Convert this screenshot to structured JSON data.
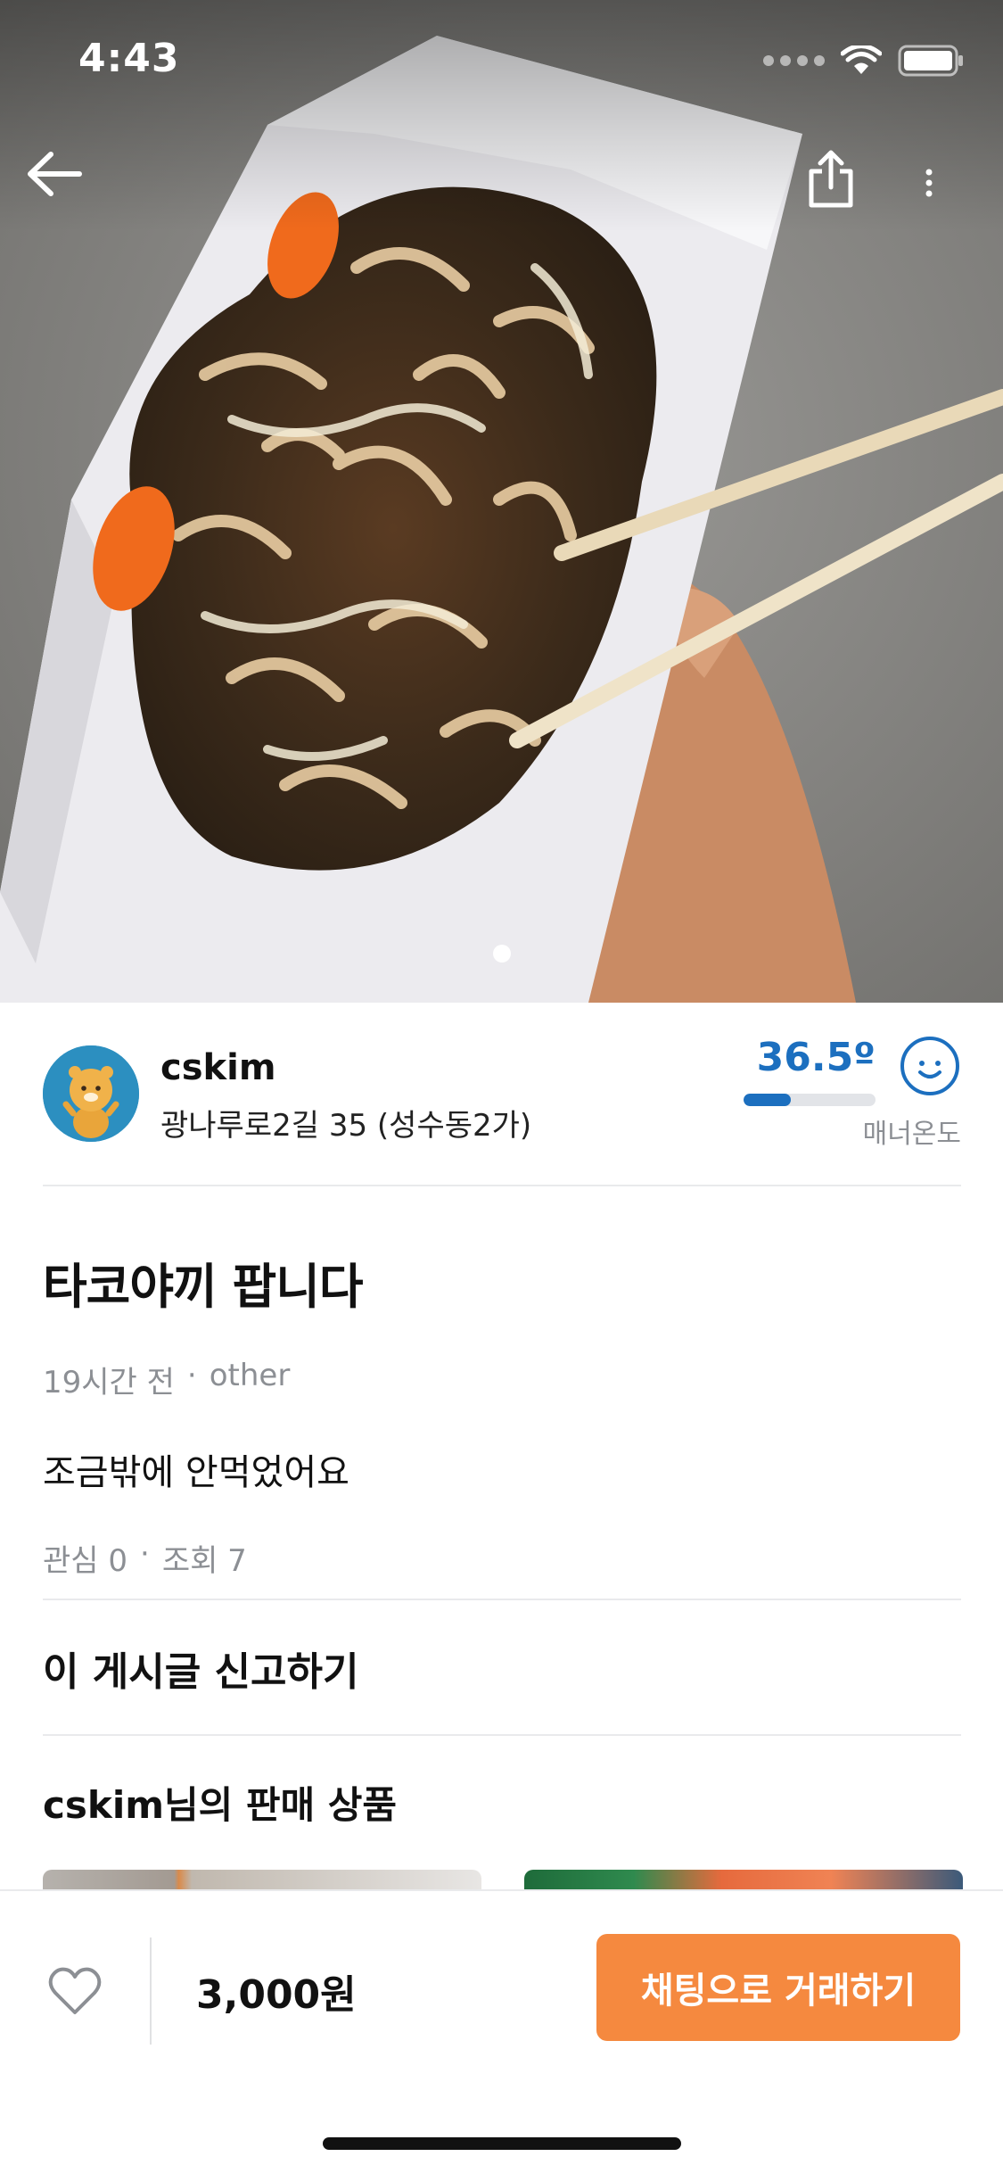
{
  "status_bar": {
    "time": "4:43"
  },
  "hero": {
    "image": "takoyaki-photo",
    "current_page": 1,
    "page_count": 1
  },
  "header": {
    "back_icon": "arrow-left-icon",
    "share_icon": "share-icon",
    "more_icon": "more-vertical-icon"
  },
  "seller": {
    "nickname": "cskim",
    "address": "광나루로2길 35 (성수동2가)",
    "manner_temperature": "36.5º",
    "manner_label": "매너온도",
    "temperature_fill": 0.36,
    "temperature_color": "#1c6fbf"
  },
  "post": {
    "title": "타코야끼 팝니다",
    "time_ago": "19시간 전",
    "category": "other",
    "description": "조금밖에 안먹었어요",
    "interest": "관심 0",
    "views": "조회 7",
    "separator": "·"
  },
  "report_label": "이 게시글 신고하기",
  "seller_items_title": "cskim님의 판매 상품",
  "bottom_bar": {
    "price": "3,000원",
    "chat_button": "채팅으로 거래하기",
    "like_icon": "heart-outline-icon",
    "accent_color": "#f5893f"
  }
}
